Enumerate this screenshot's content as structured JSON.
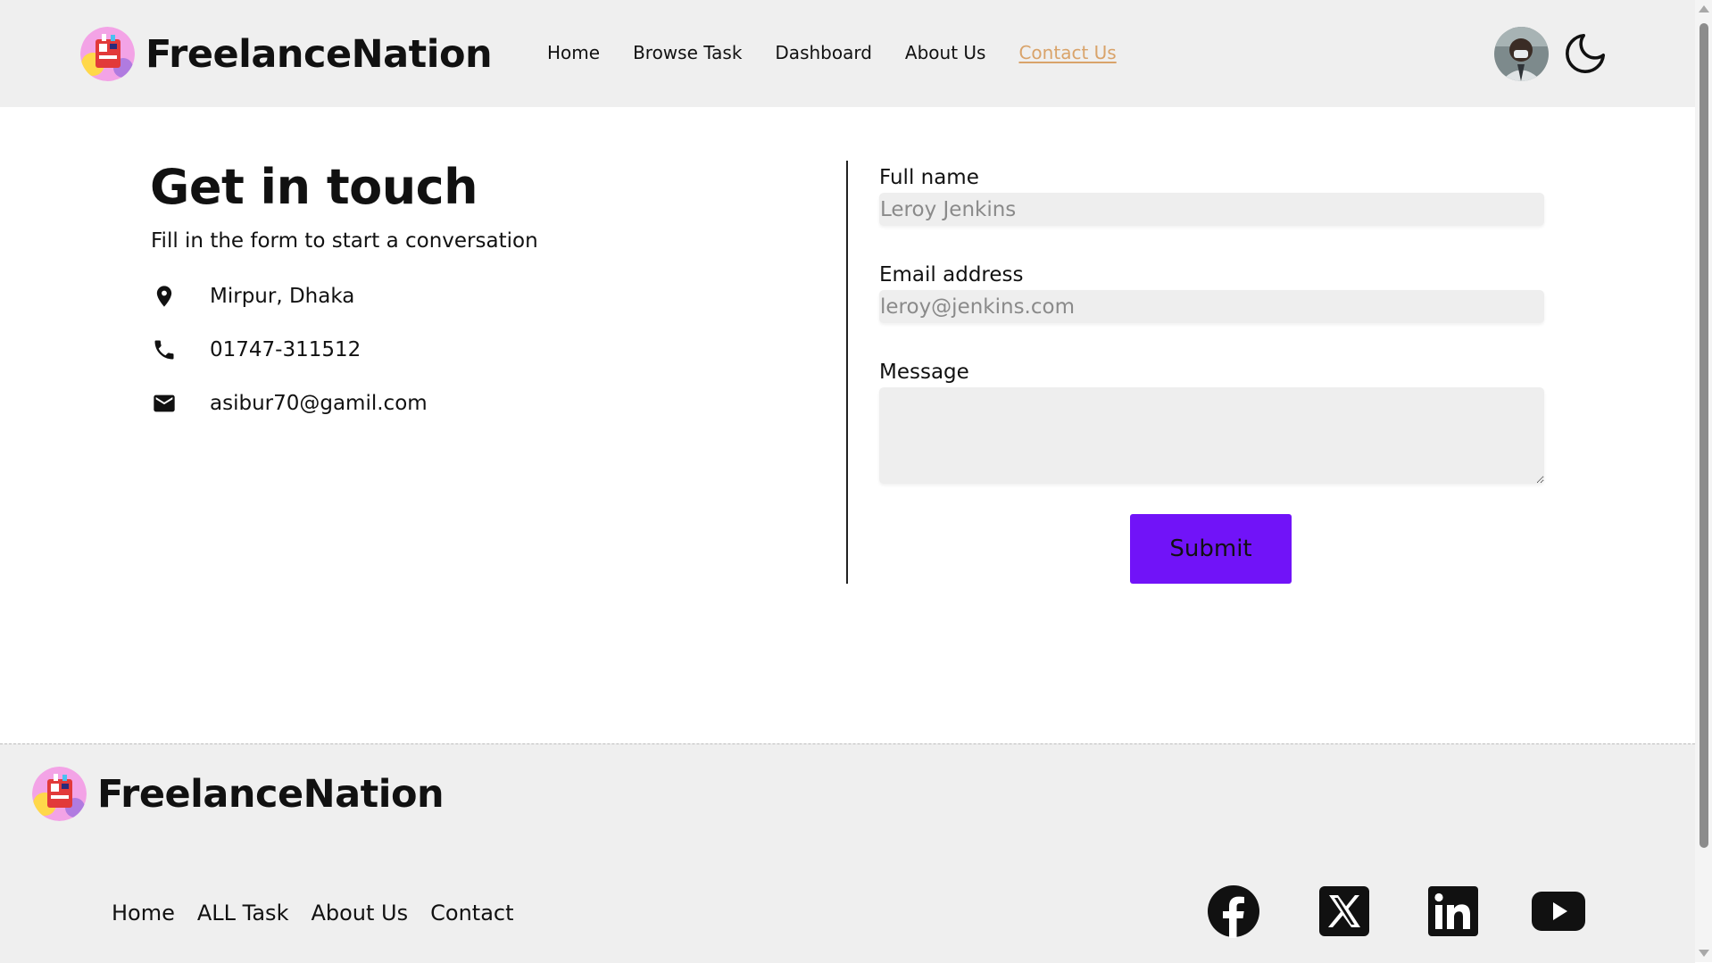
{
  "brand": {
    "name": "FreelanceNation"
  },
  "nav": {
    "items": [
      {
        "label": "Home"
      },
      {
        "label": "Browse Task"
      },
      {
        "label": "Dashboard"
      },
      {
        "label": "About Us"
      },
      {
        "label": "Contact Us",
        "active": true
      }
    ],
    "active_color": "#d9a36a"
  },
  "contact": {
    "title": "Get in touch",
    "subtitle": "Fill in the form to start a conversation",
    "location": "Mirpur, Dhaka",
    "phone": "01747-311512",
    "email": "asibur70@gamil.com"
  },
  "form": {
    "fullname_label": "Full name",
    "fullname_placeholder": "Leroy Jenkins",
    "email_label": "Email address",
    "email_placeholder": "leroy@jenkins.com",
    "message_label": "Message",
    "message_value": "",
    "submit_label": "Submit",
    "submit_color": "#7113f8"
  },
  "footer": {
    "brand": "FreelanceNation",
    "links": [
      "Home",
      "ALL Task",
      "About Us",
      "Contact"
    ],
    "social": [
      "facebook-icon",
      "x-icon",
      "linkedin-icon",
      "youtube-icon"
    ]
  }
}
